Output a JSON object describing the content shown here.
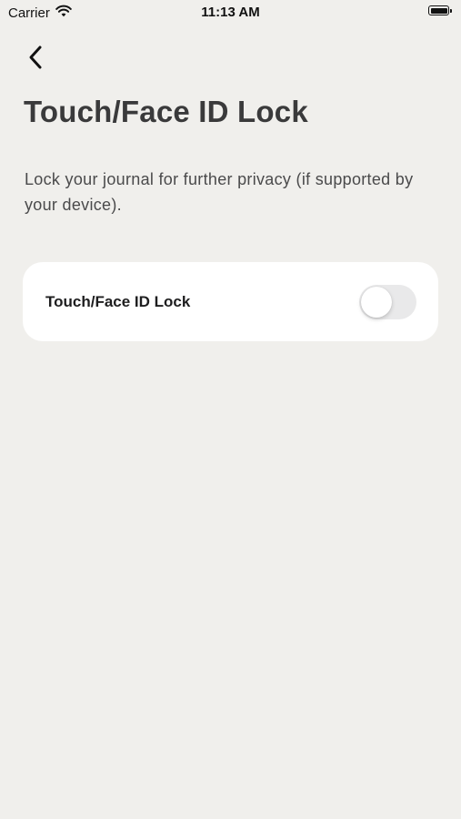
{
  "status_bar": {
    "carrier": "Carrier",
    "time": "11:13 AM",
    "wifi_icon": "wifi-icon",
    "battery_icon": "battery-icon"
  },
  "nav": {
    "back_icon": "chevron-left-icon"
  },
  "page": {
    "title": "Touch/Face ID Lock",
    "description": "Lock your journal for further privacy (if supported by your device)."
  },
  "settings": {
    "items": [
      {
        "label": "Touch/Face ID Lock",
        "toggle_on": false
      }
    ]
  },
  "colors": {
    "background": "#F0EFEC",
    "card": "#FFFFFF",
    "toggle_off_track": "#E9E9EA",
    "title_text": "#3A3A3B"
  }
}
